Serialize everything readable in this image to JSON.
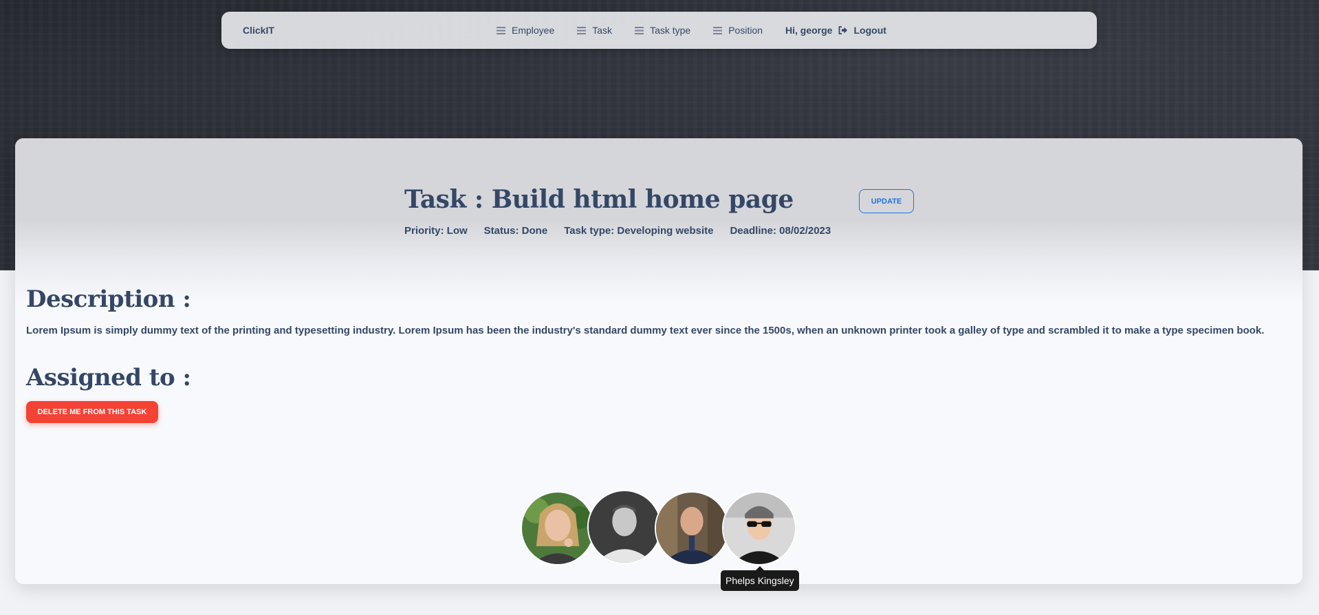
{
  "navbar": {
    "brand": "ClickIT",
    "links": [
      {
        "label": "Employee",
        "icon": "list-icon"
      },
      {
        "label": "Task",
        "icon": "list-icon"
      },
      {
        "label": "Task type",
        "icon": "list-icon"
      },
      {
        "label": "Position",
        "icon": "list-icon"
      }
    ],
    "greeting": "Hi, george",
    "logout_label": "Logout",
    "logout_icon": "sign-out-icon"
  },
  "task": {
    "title": "Task : Build html home page",
    "update_label": "UPDATE",
    "priority": "Priority: Low",
    "status": "Status: Done",
    "task_type": "Task type: Developing website",
    "deadline": "Deadline: 08/02/2023"
  },
  "description": {
    "heading": "Description :",
    "text": "Lorem Ipsum is simply dummy text of the printing and typesetting industry. Lorem Ipsum has been the industry's standard dummy text ever since the 1500s, when an unknown printer took a galley of type and scrambled it to make a type specimen book."
  },
  "assigned": {
    "heading": "Assigned to :",
    "delete_label": "DELETE ME FROM THIS TASK",
    "tooltip": "Phelps Kingsley"
  },
  "colors": {
    "primary_text": "#344767",
    "accent_blue": "#1a73e8",
    "danger": "#f44335"
  }
}
